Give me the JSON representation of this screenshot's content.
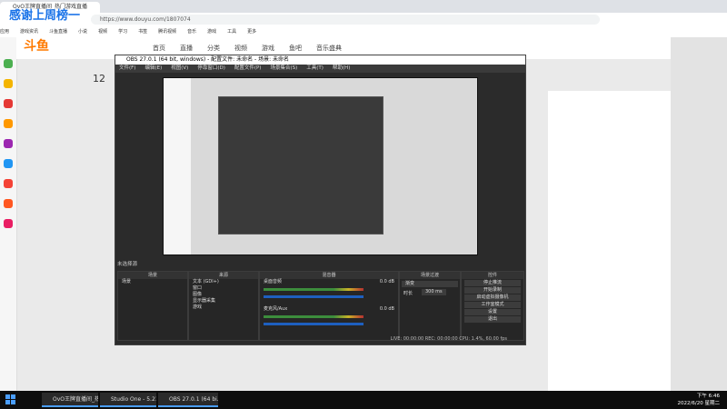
{
  "browser": {
    "tab_title": "OvO王牌直播间_热门游戏直播",
    "url": "https://www.douyu.com/1807074",
    "bookmarks": [
      "应用",
      "游戏资讯",
      "斗鱼直播",
      "小说",
      "视频",
      "学习",
      "书签",
      "腾讯视频",
      "音乐",
      "游戏",
      "工具",
      "更多"
    ]
  },
  "page": {
    "stream_title": "感谢上周榜一",
    "logo": "斗鱼",
    "nav_links": [
      "首页",
      "直播",
      "分类",
      "视频",
      "游戏",
      "鱼吧",
      "音乐盛典"
    ],
    "time_badge": "12"
  },
  "obs": {
    "title": "OBS 27.0.1 (64 bit, windows) - 配置文件: 未命名 - 场景: 未命名",
    "menu": [
      "文件(F)",
      "编辑(E)",
      "视图(V)",
      "停靠窗口(D)",
      "配置文件(P)",
      "场景集合(S)",
      "工具(T)",
      "帮助(H)"
    ],
    "scene_label": "未选择源",
    "docks": {
      "scenes": {
        "title": "场景",
        "items": [
          "场景"
        ]
      },
      "sources": {
        "title": "来源",
        "items": [
          "文本 (GDI+)",
          "窗口",
          "图像",
          "显示器采集",
          "游戏"
        ]
      },
      "mixer": {
        "title": "混音器",
        "channels": [
          {
            "name": "桌面音频",
            "level": "0.0 dB"
          },
          {
            "name": "麦克风/Aux",
            "level": "0.0 dB"
          }
        ]
      },
      "transitions": {
        "title": "场景过渡",
        "type": "渐变",
        "duration_label": "时长",
        "duration": "300 ms"
      },
      "controls": {
        "title": "控件",
        "buttons": [
          "停止推流",
          "开始录制",
          "启动虚拟摄像机",
          "工作室模式",
          "设置",
          "退出"
        ]
      }
    },
    "status": "LIVE: 00:00:00   REC: 00:00:00   CPU: 1.4%, 60.00 fps"
  },
  "taskbar": {
    "tasks": [
      "OvO王牌直播间_热...",
      "Studio One - 5.21",
      "OBS 27.0.1 (64 bi..."
    ],
    "time": "下午 6:46",
    "date": "2022/6/20 星期二"
  }
}
